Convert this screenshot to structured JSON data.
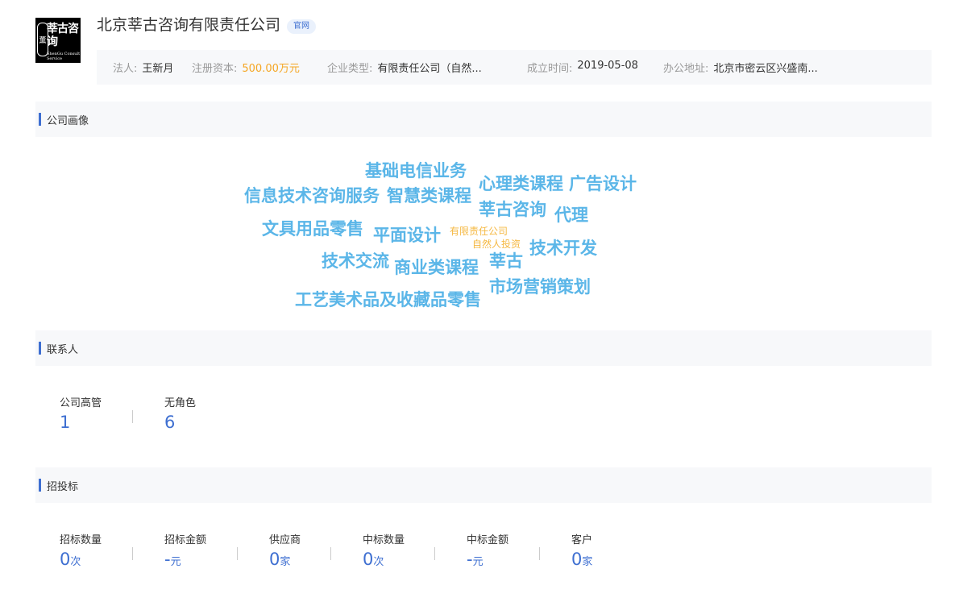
{
  "logo": {
    "seal": "薫",
    "text": "莘古咨询",
    "subtext": "ShenGu Consult Service"
  },
  "company": {
    "name": "北京莘古咨询有限责任公司",
    "badge": "官网"
  },
  "info": [
    {
      "label": "法人:",
      "value": "王新月"
    },
    {
      "label": "注册资本:",
      "value": "500.00万元"
    },
    {
      "label": "企业类型:",
      "value": "有限责任公司（自然..."
    },
    {
      "label": "成立时间:",
      "value": "2019-05-08"
    },
    {
      "label": "办公地址:",
      "value": "北京市密云区兴盛南..."
    }
  ],
  "sections": {
    "portrait": "公司画像",
    "contacts": "联系人",
    "bidding": "招投标"
  },
  "tag_cloud": [
    {
      "text": "基础电信业务"
    },
    {
      "text": "心理类课程"
    },
    {
      "text": "广告设计"
    },
    {
      "text": "信息技术咨询服务"
    },
    {
      "text": "智慧类课程"
    },
    {
      "text": "莘古咨询"
    },
    {
      "text": "代理"
    },
    {
      "text": "文具用品零售"
    },
    {
      "text": "平面设计"
    },
    {
      "text": "有限责任公司"
    },
    {
      "text": "自然人投资"
    },
    {
      "text": "技术开发"
    },
    {
      "text": "技术交流"
    },
    {
      "text": "商业类课程"
    },
    {
      "text": "莘古"
    },
    {
      "text": "市场营销策划"
    },
    {
      "text": "工艺美术品及收藏品零售"
    }
  ],
  "contacts": [
    {
      "label": "公司高管",
      "value": "1",
      "unit": ""
    },
    {
      "label": "无角色",
      "value": "6",
      "unit": ""
    }
  ],
  "bidding": [
    {
      "label": "招标数量",
      "value": "0",
      "unit": "次"
    },
    {
      "label": "招标金额",
      "value": "-",
      "unit": "元"
    },
    {
      "label": "供应商",
      "value": "0",
      "unit": "家"
    },
    {
      "label": "中标数量",
      "value": "0",
      "unit": "次"
    },
    {
      "label": "中标金额",
      "value": "-",
      "unit": "元"
    },
    {
      "label": "客户",
      "value": "0",
      "unit": "家"
    }
  ]
}
